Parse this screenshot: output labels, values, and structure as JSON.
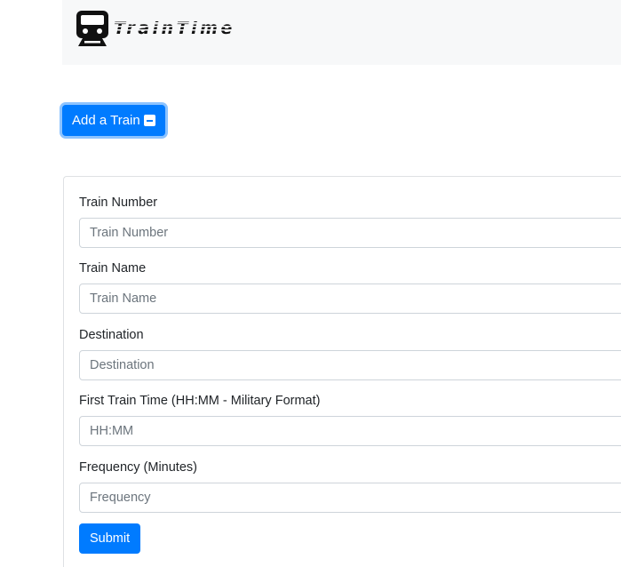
{
  "brand": {
    "logo_text": "TrainTime",
    "icon": "train-icon"
  },
  "toggle": {
    "label": "Add a Train",
    "icon": "minus-square-icon",
    "color": "#007bff"
  },
  "form": {
    "fields": [
      {
        "label": "Train Number",
        "placeholder": "Train Number"
      },
      {
        "label": "Train Name",
        "placeholder": "Train Name"
      },
      {
        "label": "Destination",
        "placeholder": "Destination"
      },
      {
        "label": "First Train Time (HH:MM - Military Format)",
        "placeholder": "HH:MM"
      },
      {
        "label": "Frequency (Minutes)",
        "placeholder": "Frequency"
      }
    ],
    "submit_label": "Submit"
  },
  "colors": {
    "primary": "#007bff",
    "navbar_bg": "#f7f8f9",
    "border": "#ced4da"
  }
}
